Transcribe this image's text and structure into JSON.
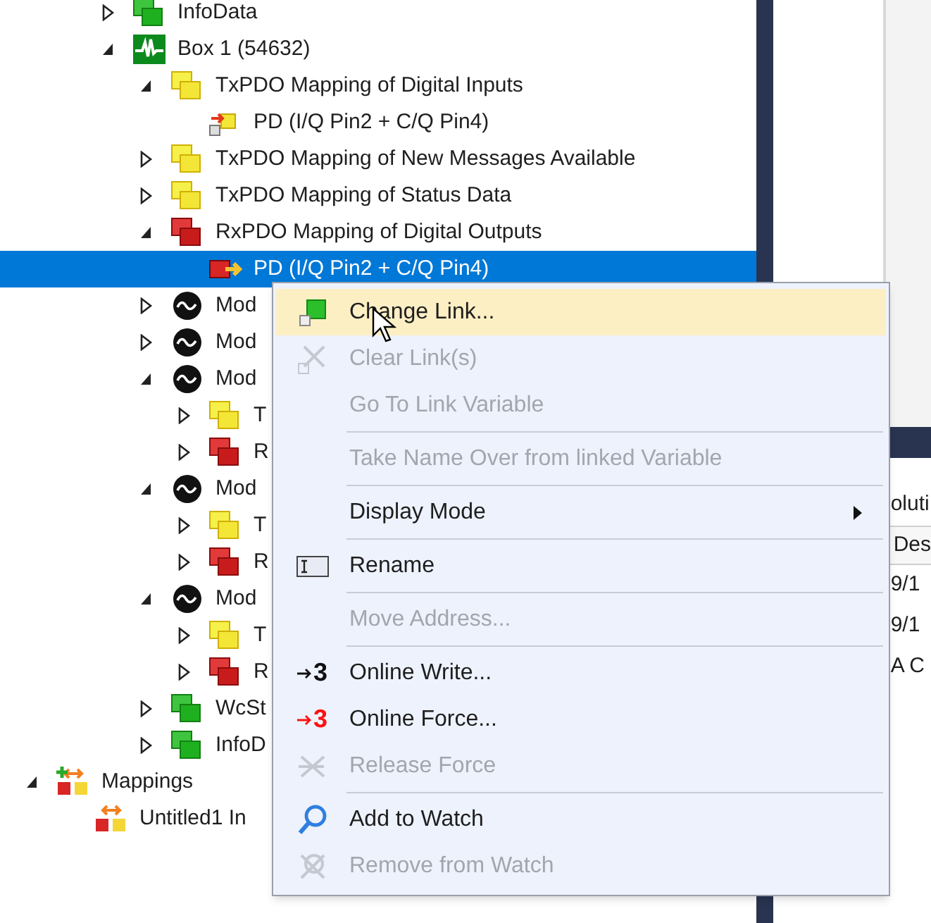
{
  "tree": {
    "device_items": [
      {
        "label": "InfoData",
        "kind": "green",
        "expanded": false,
        "selected": false
      },
      {
        "label": "Box 1 (54632)",
        "kind": "box",
        "expanded": true,
        "selected": false,
        "children": [
          {
            "label": "TxPDO Mapping of Digital Inputs",
            "kind": "yellow",
            "expanded": true,
            "selected": false,
            "children": [
              {
                "label": "PD (I/Q Pin2 + C/Q Pin4)",
                "kind": "pd_in",
                "selected": false
              }
            ]
          },
          {
            "label": "TxPDO Mapping of New Messages Available",
            "kind": "yellow",
            "expanded": false,
            "selected": false
          },
          {
            "label": "TxPDO Mapping of Status Data",
            "kind": "yellow",
            "expanded": false,
            "selected": false
          },
          {
            "label": "RxPDO Mapping of Digital Outputs",
            "kind": "red",
            "expanded": true,
            "selected": false,
            "children": [
              {
                "label": "PD (I/Q Pin2 + C/Q Pin4)",
                "kind": "pd_out",
                "selected": true
              }
            ]
          },
          {
            "label": "Mod",
            "kind": "module",
            "expanded": false,
            "selected": false
          },
          {
            "label": "Mod",
            "kind": "module",
            "expanded": false,
            "selected": false
          },
          {
            "label": "Mod",
            "kind": "module",
            "expanded": true,
            "selected": false,
            "children": [
              {
                "label": "T",
                "kind": "yellow",
                "expanded": false,
                "selected": false
              },
              {
                "label": "R",
                "kind": "red",
                "expanded": false,
                "selected": false
              }
            ]
          },
          {
            "label": "Mod",
            "kind": "module",
            "expanded": true,
            "selected": false,
            "children": [
              {
                "label": "T",
                "kind": "yellow",
                "expanded": false,
                "selected": false
              },
              {
                "label": "R",
                "kind": "red",
                "expanded": false,
                "selected": false
              }
            ]
          },
          {
            "label": "Mod",
            "kind": "module",
            "expanded": true,
            "selected": false,
            "children": [
              {
                "label": "T",
                "kind": "yellow",
                "expanded": false,
                "selected": false
              },
              {
                "label": "R",
                "kind": "red",
                "expanded": false,
                "selected": false
              }
            ]
          },
          {
            "label": "WcSt",
            "kind": "green",
            "expanded": false,
            "selected": false
          },
          {
            "label": "InfoD",
            "kind": "green",
            "expanded": false,
            "selected": false
          }
        ]
      }
    ],
    "root_items": [
      {
        "label": "Mappings",
        "kind": "mappings",
        "expanded": true,
        "selected": false,
        "children": [
          {
            "label": "Untitled1 In",
            "kind": "mapping",
            "selected": false
          }
        ]
      }
    ]
  },
  "right_panel": {
    "tab": "oluti",
    "column_header": "Des",
    "rows": [
      "9/1",
      "9/1",
      "A C"
    ]
  },
  "context_menu": [
    {
      "kind": "link",
      "label": "Change Link...",
      "disabled": false,
      "highlighted": true
    },
    {
      "kind": "clear-link",
      "label": "Clear Link(s)",
      "disabled": true,
      "highlighted": false
    },
    {
      "kind": "item",
      "label": "Go To Link Variable",
      "disabled": true,
      "highlighted": false
    },
    {
      "kind": "separator"
    },
    {
      "kind": "item",
      "label": "Take Name Over from linked Variable",
      "disabled": true,
      "highlighted": false
    },
    {
      "kind": "separator"
    },
    {
      "kind": "item",
      "label": "Display Mode",
      "disabled": false,
      "highlighted": false,
      "submenu": true
    },
    {
      "kind": "separator"
    },
    {
      "kind": "rename",
      "label": "Rename",
      "disabled": false,
      "highlighted": false
    },
    {
      "kind": "separator"
    },
    {
      "kind": "item",
      "label": "Move Address...",
      "disabled": true,
      "highlighted": false
    },
    {
      "kind": "separator"
    },
    {
      "kind": "write",
      "label": "Online Write...",
      "icon_glyph": "3",
      "disabled": false,
      "highlighted": false
    },
    {
      "kind": "force",
      "label": "Online Force...",
      "icon_glyph": "3",
      "disabled": false,
      "highlighted": false
    },
    {
      "kind": "release",
      "label": "Release Force",
      "disabled": true,
      "highlighted": false
    },
    {
      "kind": "separator"
    },
    {
      "kind": "watch",
      "label": "Add to Watch",
      "disabled": false,
      "highlighted": false
    },
    {
      "kind": "remove-watch",
      "label": "Remove from Watch",
      "disabled": true,
      "highlighted": false
    }
  ]
}
